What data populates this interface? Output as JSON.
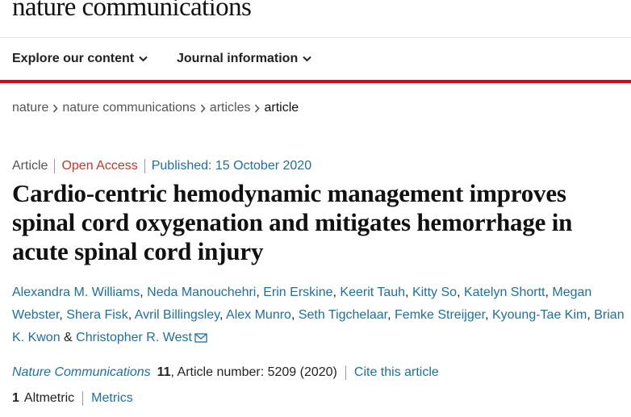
{
  "site": {
    "logo_text": "nature communications"
  },
  "nav": {
    "items": [
      {
        "label": "Explore our content"
      },
      {
        "label": "Journal information"
      }
    ]
  },
  "breadcrumb": {
    "items": [
      "nature",
      "nature communications",
      "articles",
      "article"
    ]
  },
  "article": {
    "type": "Article",
    "access": "Open Access",
    "published": "Published: 15 October 2020",
    "title": "Cardio-centric hemodynamic management improves spinal cord oxygenation and mitigates hemorrhage in acute spinal cord injury",
    "authors": [
      "Alexandra M. Williams",
      "Neda Manouchehri",
      "Erin Erskine",
      "Keerit Tauh",
      "Kitty So",
      "Katelyn Shortt",
      "Megan Webster",
      "Shera Fisk",
      "Avril Billingsley",
      "Alex Munro",
      "Seth Tigchelaar",
      "Femke Streijger",
      "Kyoung-Tae Kim",
      "Brian K. Kwon",
      "Christopher R. West"
    ],
    "author_sep": ", ",
    "author_last_sep": " & ",
    "citation": {
      "journal": "Nature Communications",
      "volume": "11",
      "article_number": ", Article number: 5209 (2020)",
      "cite_label": "Cite this article"
    },
    "metrics": {
      "altmetric_count": "1",
      "altmetric_label": "Altmetric",
      "metrics_label": "Metrics"
    }
  },
  "colors": {
    "accent": "#e2001a",
    "link": "#1f6f9f",
    "open_access": "#c0392b"
  },
  "icons": {
    "chevron": "chevron-down-icon",
    "breadcrumb_sep": "chevron-right-icon",
    "corresponding": "mail-icon"
  }
}
